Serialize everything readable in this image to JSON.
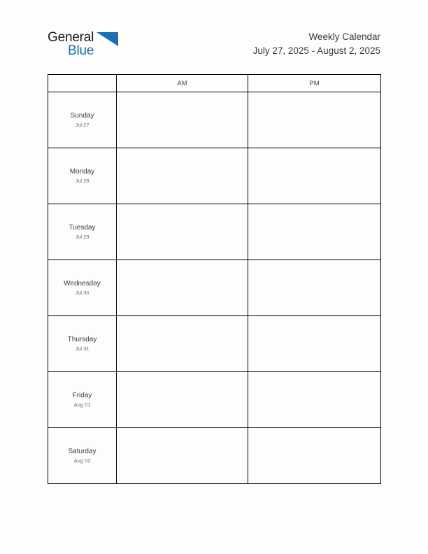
{
  "brand": {
    "word_one": "General",
    "word_two": "Blue",
    "triangle_icon": "triangle-icon",
    "colors": {
      "text_dark": "#1c1c1c",
      "blue": "#1a6fb5"
    }
  },
  "header": {
    "title": "Weekly Calendar",
    "subtitle": "July 27, 2025 - August 2, 2025"
  },
  "table": {
    "columns": [
      {
        "key": "day",
        "label": ""
      },
      {
        "key": "am",
        "label": "AM"
      },
      {
        "key": "pm",
        "label": "PM"
      }
    ],
    "rows": [
      {
        "day": "Sunday",
        "date": "Jul 27",
        "am": "",
        "pm": ""
      },
      {
        "day": "Monday",
        "date": "Jul 28",
        "am": "",
        "pm": ""
      },
      {
        "day": "Tuesday",
        "date": "Jul 29",
        "am": "",
        "pm": ""
      },
      {
        "day": "Wednesday",
        "date": "Jul 30",
        "am": "",
        "pm": ""
      },
      {
        "day": "Thursday",
        "date": "Jul 31",
        "am": "",
        "pm": ""
      },
      {
        "day": "Friday",
        "date": "Aug 01",
        "am": "",
        "pm": ""
      },
      {
        "day": "Saturday",
        "date": "Aug 02",
        "am": "",
        "pm": ""
      }
    ]
  }
}
